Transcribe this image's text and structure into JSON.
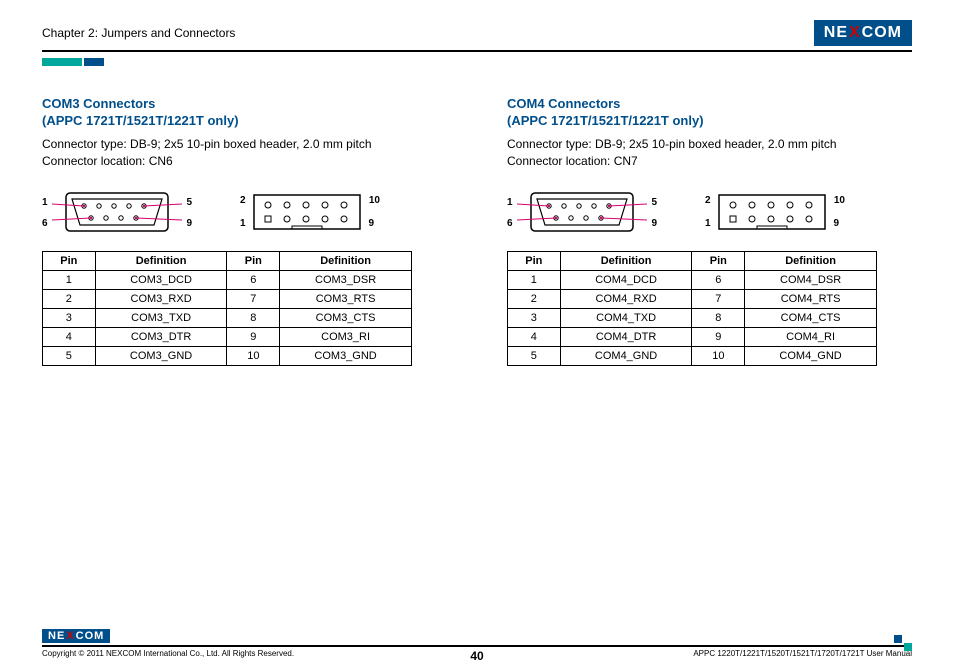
{
  "header": {
    "chapter": "Chapter 2: Jumpers and Connectors",
    "brand_pre": "NE",
    "brand_x": "X",
    "brand_post": "COM"
  },
  "col_left": {
    "title_l1": "COM3 Connectors",
    "title_l2": "(APPC 1721T/1521T/1221T only)",
    "desc_l1": "Connector type: DB-9; 2x5 10-pin boxed header, 2.0 mm pitch",
    "desc_l2": "Connector location: CN6",
    "db9_labels": {
      "tl": "1",
      "tr": "5",
      "bl": "6",
      "br": "9"
    },
    "hdr_labels": {
      "tl": "2",
      "tr": "10",
      "bl": "1",
      "br": "9"
    },
    "table": {
      "h1": "Pin",
      "h2": "Definition",
      "h3": "Pin",
      "h4": "Definition",
      "rows": [
        [
          "1",
          "COM3_DCD",
          "6",
          "COM3_DSR"
        ],
        [
          "2",
          "COM3_RXD",
          "7",
          "COM3_RTS"
        ],
        [
          "3",
          "COM3_TXD",
          "8",
          "COM3_CTS"
        ],
        [
          "4",
          "COM3_DTR",
          "9",
          "COM3_RI"
        ],
        [
          "5",
          "COM3_GND",
          "10",
          "COM3_GND"
        ]
      ]
    }
  },
  "col_right": {
    "title_l1": "COM4 Connectors",
    "title_l2": "(APPC 1721T/1521T/1221T only)",
    "desc_l1": "Connector type: DB-9; 2x5 10-pin boxed header, 2.0 mm pitch",
    "desc_l2": "Connector location: CN7",
    "db9_labels": {
      "tl": "1",
      "tr": "5",
      "bl": "6",
      "br": "9"
    },
    "hdr_labels": {
      "tl": "2",
      "tr": "10",
      "bl": "1",
      "br": "9"
    },
    "table": {
      "h1": "Pin",
      "h2": "Definition",
      "h3": "Pin",
      "h4": "Definition",
      "rows": [
        [
          "1",
          "COM4_DCD",
          "6",
          "COM4_DSR"
        ],
        [
          "2",
          "COM4_RXD",
          "7",
          "COM4_RTS"
        ],
        [
          "3",
          "COM4_TXD",
          "8",
          "COM4_CTS"
        ],
        [
          "4",
          "COM4_DTR",
          "9",
          "COM4_RI"
        ],
        [
          "5",
          "COM4_GND",
          "10",
          "COM4_GND"
        ]
      ]
    }
  },
  "footer": {
    "copyright": "Copyright © 2011 NEXCOM International Co., Ltd. All Rights Reserved.",
    "page": "40",
    "model": "APPC 1220T/1221T/1520T/1521T/1720T/1721T User Manual",
    "brand_pre": "NE",
    "brand_x": "X",
    "brand_post": "COM"
  }
}
